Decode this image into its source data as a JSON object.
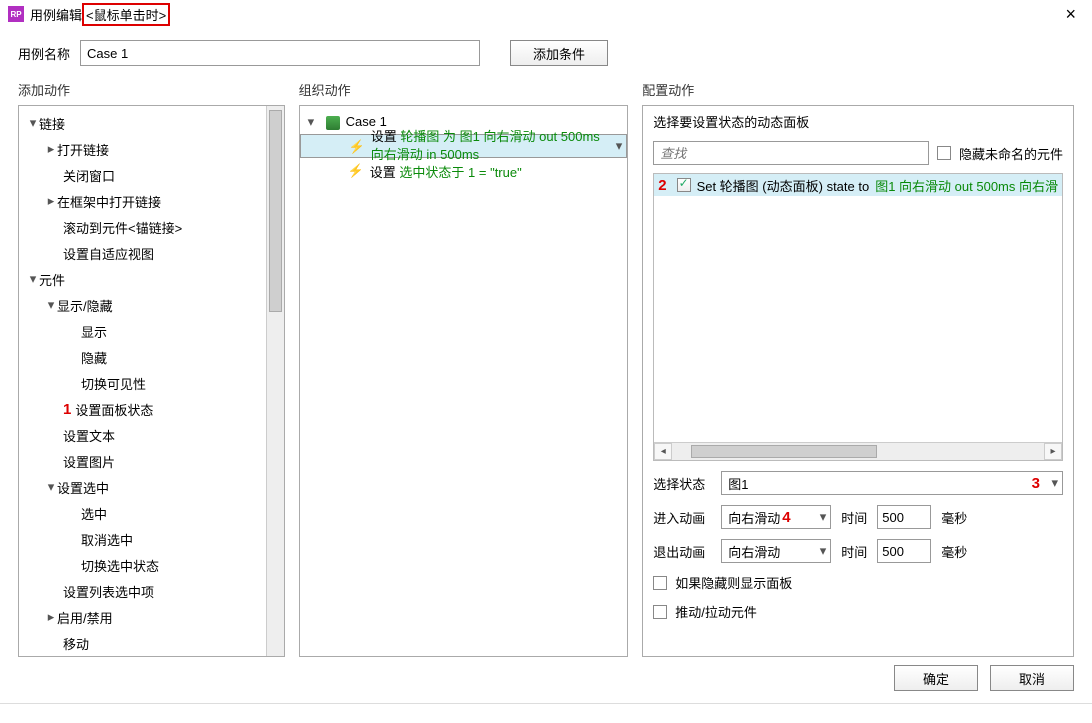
{
  "title": {
    "prefix": "用例编辑",
    "highlight": "<鼠标单击时>"
  },
  "name_label": "用例名称",
  "name_value": "Case 1",
  "add_condition": "添加条件",
  "col_titles": {
    "left": "添加动作",
    "mid": "组织动作",
    "right": "配置动作"
  },
  "tree": {
    "links": "链接",
    "open_link": "打开链接",
    "close_win": "关闭窗口",
    "open_in_frame": "在框架中打开链接",
    "scroll_anchor": "滚动到元件<锚链接>",
    "responsive": "设置自适应视图",
    "widgets": "元件",
    "show_hide": "显示/隐藏",
    "show": "显示",
    "hide": "隐藏",
    "toggle_vis": "切换可见性",
    "set_panel_state": "设置面板状态",
    "set_text": "设置文本",
    "set_image": "设置图片",
    "set_selected": "设置选中",
    "sel_on": "选中",
    "sel_off": "取消选中",
    "toggle_sel": "切换选中状态",
    "set_list": "设置列表选中项",
    "enable_disable": "启用/禁用",
    "move": "移动"
  },
  "annot": {
    "one": "1",
    "two": "2",
    "three": "3",
    "four": "4"
  },
  "mid": {
    "case_name": "Case 1",
    "act1_pre": "设置 ",
    "act1_green": "轮播图 为 图1 向右滑动 out 500ms 向右滑动 in 500ms",
    "act2_pre": "设置 ",
    "act2_green": "选中状态于 1 = \"true\""
  },
  "cfg": {
    "head": "选择要设置状态的动态面板",
    "search_ph": "查找",
    "hide_unnamed": "隐藏未命名的元件",
    "row_pre": "Set 轮播图 (动态面板) state to ",
    "row_green": "图1 向右滑动 out 500ms 向右滑",
    "state_label": "选择状态",
    "state_value": "图1",
    "in_label": "进入动画",
    "in_value": "向右滑动",
    "out_label": "退出动画",
    "out_value": "向右滑动",
    "time_label": "时间",
    "time_in": "500",
    "time_out": "500",
    "ms": "毫秒",
    "chk_show": "如果隐藏则显示面板",
    "chk_push": "推动/拉动元件"
  },
  "buttons": {
    "ok": "确定",
    "cancel": "取消"
  }
}
